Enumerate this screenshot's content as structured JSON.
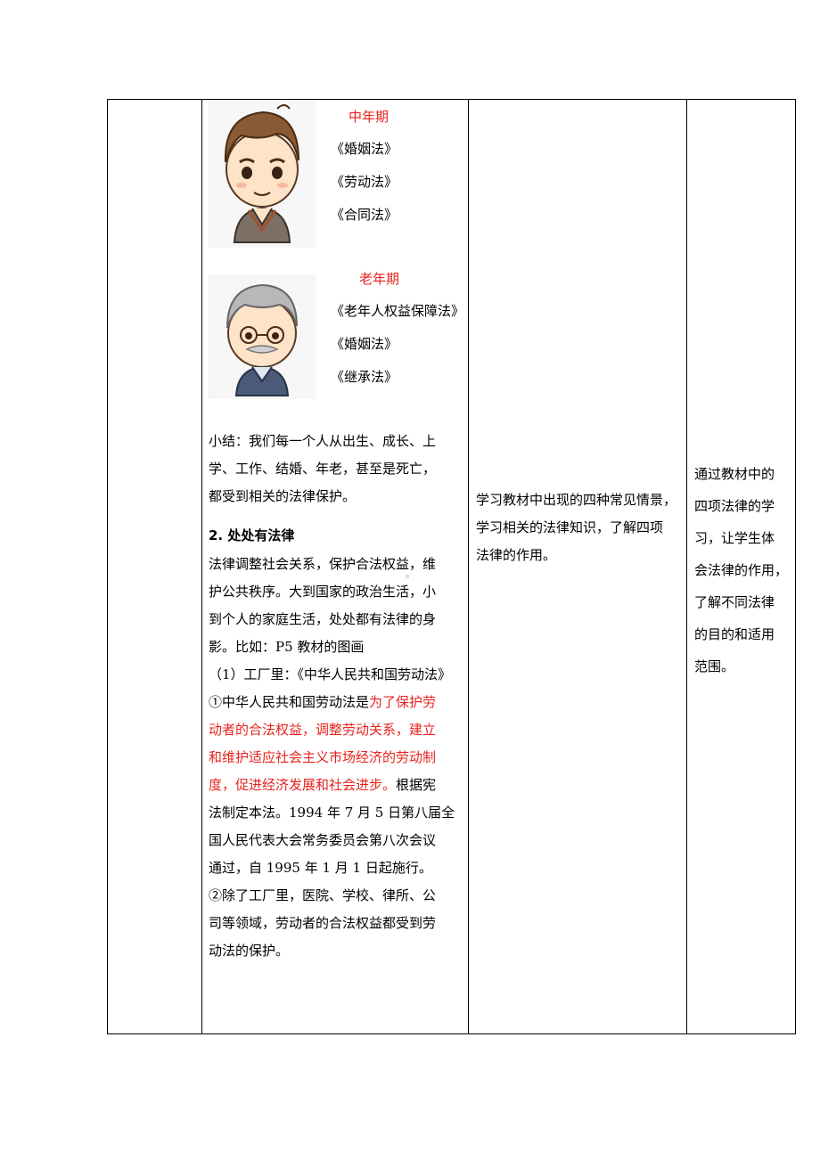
{
  "middle_age": {
    "title": "中年期",
    "laws": [
      "《婚姻法》",
      "《劳动法》",
      "《合同法》"
    ]
  },
  "old_age": {
    "title": "老年期",
    "laws": [
      "《老年人权益保障法》",
      "《婚姻法》",
      "《继承法》"
    ]
  },
  "summary_lines": [
    "小结：我们每一个人从出生、成长、上",
    "学、工作、结婚、年老，甚至是死亡，",
    "都受到相关的法律保护。"
  ],
  "section_heading": "2.  处处有法律",
  "body_lines": [
    "法律调整社会关系，保护合法权益，维",
    "护公共秩序。大到国家的政治生活，小",
    "到个人的家庭生活，处处都有法律的身",
    "影。比如：P5 教材的图画",
    "（1）工厂里：《中华人民共和国劳动法》"
  ],
  "law_desc": {
    "line1_black": "①中华人民共和国劳动法是",
    "line1_red": "为了保护劳",
    "line2_red": "动者的合法权益，调整劳动关系，建立",
    "line3_red": "和维护适应社会主义市场经济的劳动制",
    "line4_red": "度，促进经济发展和社会进步。",
    "line4_black": "根据宪",
    "line5": "法制定本法。1994 年 7 月 5 日第八届全",
    "line6": "国人民代表大会常务委员会第八次会议",
    "line7": "通过，自 1995 年 1 月 1 日起施行。"
  },
  "point2_lines": [
    "②除了工厂里，医院、学校、律所、公",
    "司等领域，劳动者的合法权益都受到劳",
    "动法的保护。"
  ],
  "student_activity_lines": [
    "学习教材中出现的四种常见情景，",
    "学习相关的法律知识，了解四项",
    "法律的作用。"
  ],
  "design_intent_lines": [
    "通过教材中的",
    "四项法律的学",
    "习，让学生体",
    "会法律的作用，",
    "了解不同法律",
    "的目的和适用",
    "范围。"
  ],
  "colors": {
    "accent_red": "#e8231f"
  }
}
